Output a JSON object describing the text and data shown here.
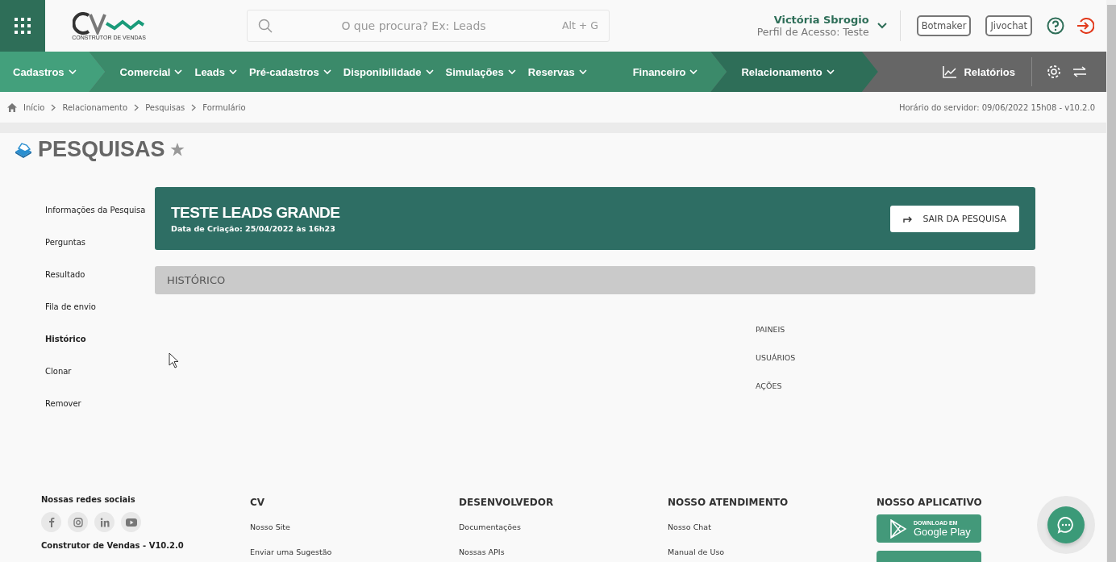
{
  "header": {
    "logo_caption": "CONSTRUTOR DE VENDAS",
    "search": {
      "placeholder": "O que procura? Ex: Leads",
      "shortcut": "Alt + G"
    },
    "user": {
      "name": "Victória Sbrogio",
      "profile": "Perfil de Acesso: Teste"
    },
    "buttons": [
      "Botmaker",
      "Jivochat"
    ]
  },
  "main_menu": [
    {
      "color": "#43a07c",
      "items": [
        "Cadastros"
      ]
    },
    {
      "color": "#3b8a6a",
      "items": [
        "Comercial",
        "Leads",
        "Pré-cadastros",
        "Disponibilidade",
        "Simulações",
        "Reservas",
        "Financeiro"
      ]
    },
    {
      "color": "#2e6e58",
      "items": [
        "Relacionamento"
      ]
    }
  ],
  "reports": "Relatórios",
  "breadcrumb": [
    "Início",
    "Relacionamento",
    "Pesquisas",
    "Formulário"
  ],
  "server_time": "Horário do servidor: 09/06/2022 15h08 - v10.2.0",
  "page_title": "PESQUISAS",
  "sidebar": [
    {
      "label": "Informações da Pesquisa",
      "selected": false
    },
    {
      "label": "Perguntas",
      "selected": false
    },
    {
      "label": "Resultado",
      "selected": false
    },
    {
      "label": "Fila de envio",
      "selected": false
    },
    {
      "label": "Histórico",
      "selected": true
    },
    {
      "label": "Clonar",
      "selected": false
    },
    {
      "label": "Remover",
      "selected": false
    }
  ],
  "survey": {
    "title": "TESTE LEADS GRANDE",
    "created": "Data de Criação: 25/04/2022 às 16h23",
    "exit_button": "SAIR DA PESQUISA"
  },
  "section_title": "HISTÓRICO",
  "history_filters": [
    "PAINEIS",
    "USUÁRIOS",
    "AÇÕES"
  ],
  "footer": {
    "social_title": "Nossas redes sociais",
    "version": "Construtor de Vendas - V10.2.0",
    "columns": [
      {
        "title": "CV",
        "links": [
          "Nosso Site",
          "Enviar uma Sugestão"
        ]
      },
      {
        "title": "DESENVOLVEDOR",
        "links": [
          "Documentações",
          "Nossas APIs"
        ]
      },
      {
        "title": "NOSSO ATENDIMENTO",
        "links": [
          "Nosso Chat",
          "Manual de Uso"
        ]
      }
    ],
    "app_title": "NOSSO APLICATIVO",
    "store_badge": {
      "small": "DOWNLOAD EM",
      "large": "Google Play"
    }
  }
}
